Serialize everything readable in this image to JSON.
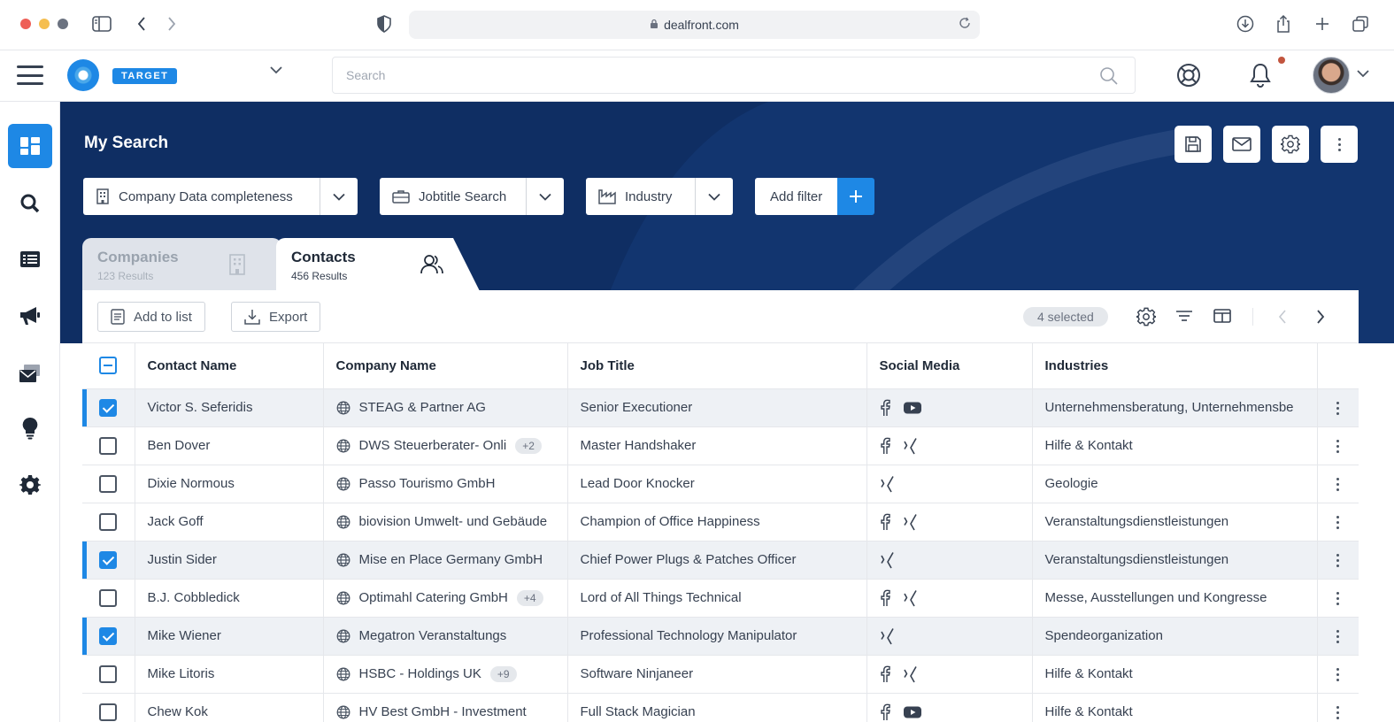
{
  "browser": {
    "url": "dealfront.com"
  },
  "header": {
    "product_badge": "TARGET",
    "search_placeholder": "Search"
  },
  "sidebar": {
    "items": [
      {
        "name": "dashboard",
        "active": true
      },
      {
        "name": "search",
        "active": false
      },
      {
        "name": "lists",
        "active": false
      },
      {
        "name": "campaigns",
        "active": false
      },
      {
        "name": "mailing",
        "active": false
      },
      {
        "name": "insights",
        "active": false
      },
      {
        "name": "settings",
        "active": false
      }
    ]
  },
  "page": {
    "title": "My Search"
  },
  "filters": [
    {
      "label": "Company Data completeness",
      "icon": "building-icon"
    },
    {
      "label": "Jobtitle Search",
      "icon": "briefcase-icon"
    },
    {
      "label": "Industry",
      "icon": "industry-icon"
    }
  ],
  "add_filter_label": "Add filter",
  "tabs": [
    {
      "label": "Companies",
      "sub": "123 Results",
      "active": false
    },
    {
      "label": "Contacts",
      "sub": "456 Results",
      "active": true
    }
  ],
  "toolbar": {
    "add_to_list": "Add to list",
    "export": "Export",
    "selected": "4 selected"
  },
  "table": {
    "columns": [
      "Contact Name",
      "Company Name",
      "Job Title",
      "Social Media",
      "Industries"
    ],
    "rows": [
      {
        "selected": true,
        "name": "Victor S. Seferidis",
        "company": "STEAG & Partner AG",
        "extra": "",
        "job": "Senior Executioner",
        "social": [
          "facebook",
          "youtube"
        ],
        "industry": "Unternehmensberatung, Unternehmensbe"
      },
      {
        "selected": false,
        "name": "Ben Dover",
        "company": "DWS Steuerberater- Onli",
        "extra": "+2",
        "job": "Master Handshaker",
        "social": [
          "facebook",
          "xing"
        ],
        "industry": "Hilfe & Kontakt"
      },
      {
        "selected": false,
        "name": "Dixie Normous",
        "company": "Passo Tourismo GmbH",
        "extra": "",
        "job": "Lead Door Knocker",
        "social": [
          "xing"
        ],
        "industry": "Geologie"
      },
      {
        "selected": false,
        "name": "Jack Goff",
        "company": "biovision Umwelt- und Gebäude",
        "extra": "",
        "job": "Champion of Office Happiness",
        "social": [
          "facebook",
          "xing"
        ],
        "industry": "Veranstaltungsdienstleistungen"
      },
      {
        "selected": true,
        "name": "Justin Sider",
        "company": "Mise en Place Germany GmbH",
        "extra": "",
        "job": "Chief Power Plugs & Patches Officer",
        "social": [
          "xing"
        ],
        "industry": "Veranstaltungsdienstleistungen"
      },
      {
        "selected": false,
        "name": "B.J. Cobbledick",
        "company": "Optimahl Catering GmbH",
        "extra": "+4",
        "job": "Lord of All Things Technical",
        "social": [
          "facebook",
          "xing"
        ],
        "industry": "Messe, Ausstellungen und Kongresse"
      },
      {
        "selected": true,
        "name": "Mike Wiener",
        "company": "Megatron Veranstaltungs",
        "extra": "",
        "job": "Professional Technology Manipulator",
        "social": [
          "xing"
        ],
        "industry": "Spendeorganization"
      },
      {
        "selected": false,
        "name": "Mike Litoris",
        "company": "HSBC - Holdings UK",
        "extra": "+9",
        "job": "Software Ninjaneer",
        "social": [
          "facebook",
          "xing"
        ],
        "industry": "Hilfe & Kontakt"
      },
      {
        "selected": false,
        "name": "Chew Kok",
        "company": "HV Best GmbH - Investment",
        "extra": "",
        "job": "Full Stack Magician",
        "social": [
          "facebook",
          "youtube"
        ],
        "industry": "Hilfe & Kontakt"
      }
    ]
  },
  "colors": {
    "accent": "#1e88e5",
    "hero_bg": "#0f2e63"
  }
}
